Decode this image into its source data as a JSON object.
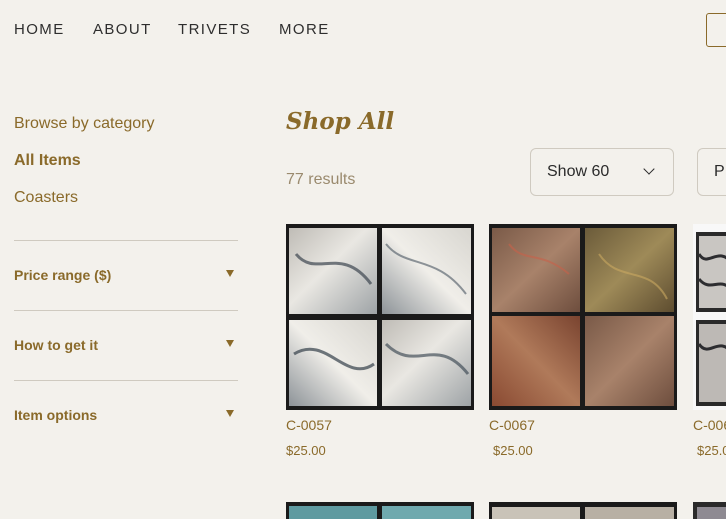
{
  "nav": {
    "items": [
      "HOME",
      "ABOUT",
      "TRIVETS",
      "MORE"
    ]
  },
  "sidebar": {
    "heading": "Browse by category",
    "categories": [
      "All Items",
      "Coasters"
    ],
    "filters": [
      "Price range ($)",
      "How to get it",
      "Item options"
    ]
  },
  "main": {
    "title": "Shop All",
    "results": "77 results",
    "show_select": "Show 60",
    "sort_select_partial": "P"
  },
  "products": [
    {
      "name": "C-0057",
      "price": "$25.00"
    },
    {
      "name": "C-0067",
      "price": "$25.00"
    },
    {
      "name": "C-006",
      "price": "$25.0"
    }
  ],
  "colors": {
    "background": "#f3f1ec",
    "accent": "#8a6a2a",
    "divider": "#cfcac0"
  }
}
